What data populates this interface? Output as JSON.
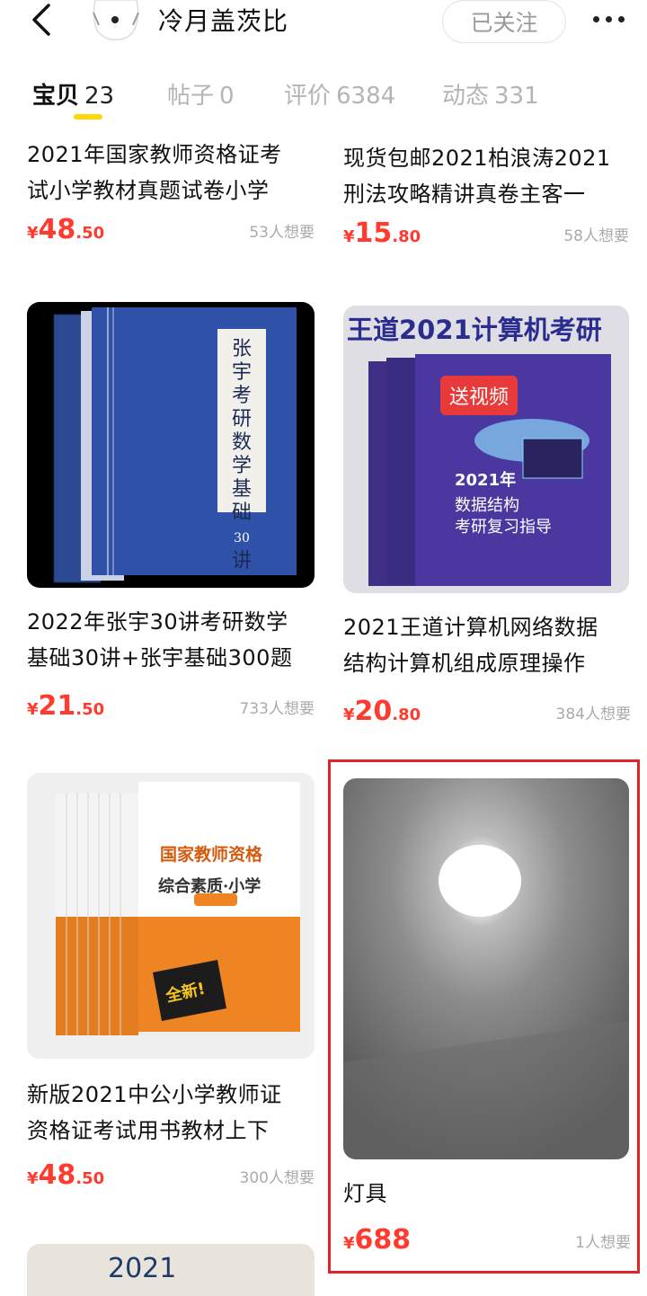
{
  "header": {
    "shop_name": "冷月盖茨比",
    "follow_label": "已关注"
  },
  "tabs": [
    {
      "label": "宝贝",
      "count": "23"
    },
    {
      "label": "帖子",
      "count": "0"
    },
    {
      "label": "评价",
      "count": "6384"
    },
    {
      "label": "动态",
      "count": "331"
    }
  ],
  "items": [
    {
      "title_l1": "2021年国家教师资格证考",
      "title_l2": "试小学教材真题试卷小学",
      "yen": "¥",
      "price_int": "48",
      "price_dec": ".50",
      "want": "53人想要"
    },
    {
      "title_l1": "现货包邮2021柏浪涛2021",
      "title_l2": "刑法攻略精讲真卷主客一",
      "yen": "¥",
      "price_int": "15",
      "price_dec": ".80",
      "want": "58人想要"
    },
    {
      "title_l1": "2022年张宇30讲考研数学",
      "title_l2": "基础30讲+张宇基础300题",
      "yen": "¥",
      "price_int": "21",
      "price_dec": ".50",
      "want": "733人想要",
      "cover_text": "张宇考研数学基础",
      "cover_num": "30",
      "cover_suffix": "讲"
    },
    {
      "title_l1": "2021王道计算机网络数据",
      "title_l2": "结构计算机组成原理操作",
      "yen": "¥",
      "price_int": "20",
      "price_dec": ".80",
      "want": "384人想要",
      "banner": "王道2021计算机考研",
      "tag": "送视频",
      "book_year": "2021年",
      "book_title1": "数据结构",
      "book_title2": "考研复习指导"
    },
    {
      "title_l1": "新版2021中公小学教师证",
      "title_l2": "资格证考试用书教材上下",
      "yen": "¥",
      "price_int": "48",
      "price_dec": ".50",
      "want": "300人想要",
      "book_title1": "国家教师资格",
      "book_title2": "综合素质·小学",
      "badge": "全新!"
    },
    {
      "title_l1": "灯具",
      "title_l2": "",
      "yen": "¥",
      "price_int": "688",
      "price_dec": "",
      "want": "1人想要"
    },
    {
      "cover_text": "2021"
    }
  ],
  "colors": {
    "price": "#ff3b30",
    "tab_underline": "#ffd60a",
    "highlight": "#e0242b"
  }
}
